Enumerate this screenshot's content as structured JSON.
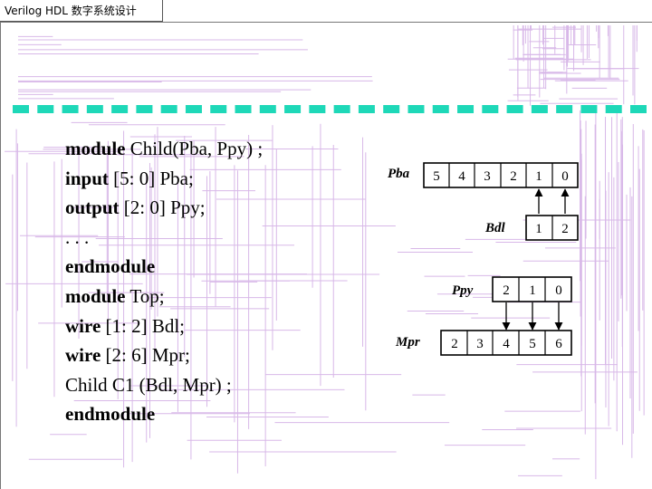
{
  "header": {
    "title": "Verilog HDL 数字系统设计"
  },
  "colors": {
    "divider": "#1ed8b8",
    "background_lines": "#d8b8e8"
  },
  "code": {
    "line1": {
      "keyword": "module",
      "rest": " Child(Pba, Ppy) ;"
    },
    "line2": {
      "keyword": "input",
      "rest": " [5: 0] Pba;"
    },
    "line3": {
      "keyword": "output",
      "rest": " [2: 0] Ppy;"
    },
    "line4": {
      "text": ". . ."
    },
    "line5": {
      "keyword": "endmodule"
    },
    "line6": {
      "keyword": "module",
      "rest": " Top;"
    },
    "line7": {
      "keyword": "wire",
      "rest": " [1: 2] Bdl;"
    },
    "line8": {
      "keyword": "wire",
      "rest": " [2: 6] Mpr;"
    },
    "line9": {
      "text": "Child C1 (Bdl, Mpr) ;"
    },
    "line10": {
      "keyword": "endmodule"
    }
  },
  "diagram": {
    "pba": {
      "label": "Pba",
      "cells": [
        "5",
        "4",
        "3",
        "2",
        "1",
        "0"
      ]
    },
    "bdl": {
      "label": "Bdl",
      "cells": [
        "1",
        "2"
      ]
    },
    "ppy": {
      "label": "Ppy",
      "cells": [
        "2",
        "1",
        "0"
      ]
    },
    "mpr": {
      "label": "Mpr",
      "cells": [
        "2",
        "3",
        "4",
        "5",
        "6"
      ]
    }
  }
}
